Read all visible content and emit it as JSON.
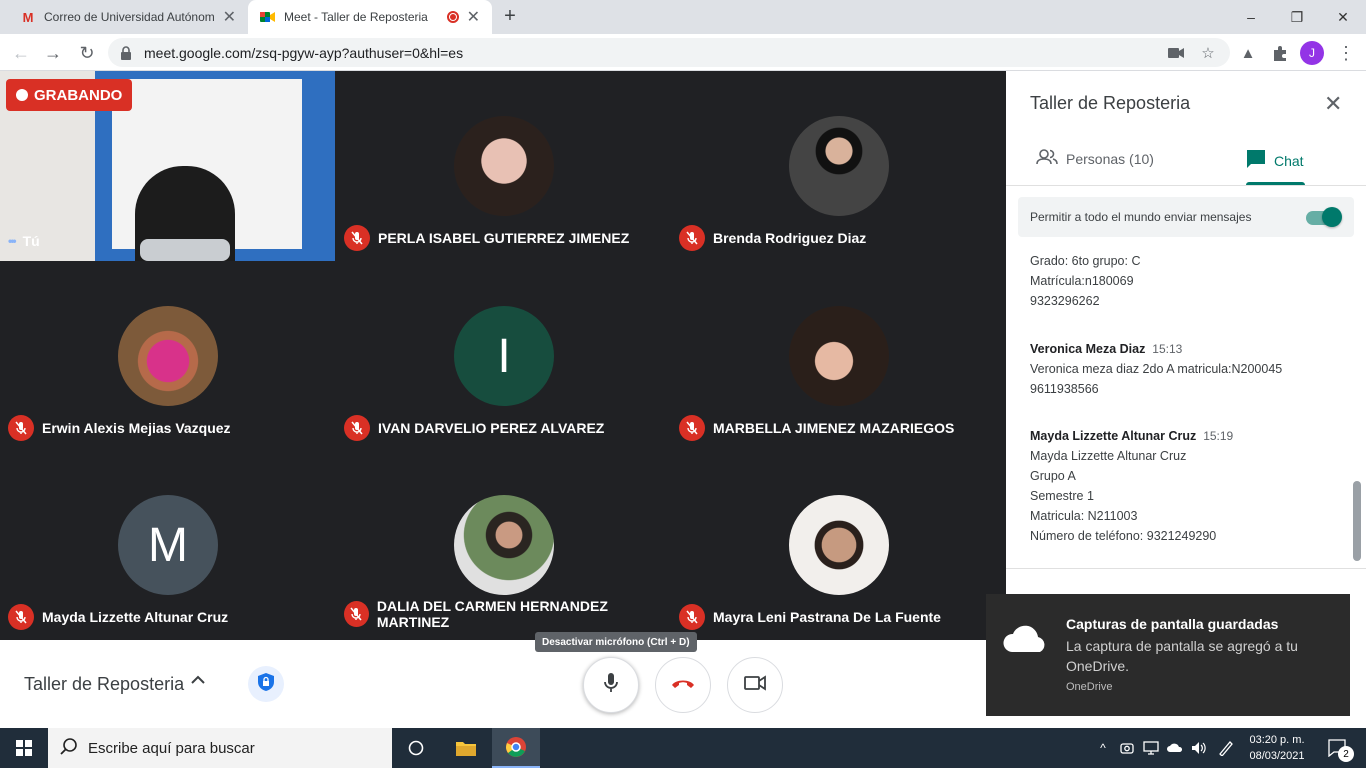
{
  "browser": {
    "tabs": [
      {
        "title": "Correo de Universidad Autónoma",
        "icon": "gmail-icon"
      },
      {
        "title": "Meet - Taller de Reposteria",
        "icon": "meet-icon",
        "recording": true
      }
    ],
    "new_tab": "+",
    "url": "meet.google.com/zsq-pgyw-ayp?authuser=0&hl=es",
    "profile_initial": "J",
    "window_controls": [
      "–",
      "❐",
      "✕"
    ]
  },
  "meeting": {
    "recording_label": "GRABANDO",
    "participants": [
      {
        "name": "Tú",
        "kind": "video",
        "muted": false
      },
      {
        "name": "PERLA ISABEL GUTIERREZ JIMENEZ",
        "kind": "photo",
        "color": "#5a3e36",
        "muted": true
      },
      {
        "name": "Brenda Rodriguez Diaz",
        "kind": "photo",
        "color": "#3a3a3a",
        "muted": true
      },
      {
        "name": "Erwin Alexis Mejias Vazquez",
        "kind": "photo",
        "color": "#c8327a",
        "muted": true
      },
      {
        "name": "IVAN DARVELIO PEREZ ALVAREZ",
        "kind": "letter",
        "letter": "I",
        "color": "#174d3e",
        "muted": true
      },
      {
        "name": "MARBELLA JIMENEZ MAZARIEGOS",
        "kind": "photo",
        "color": "#4a3a33",
        "muted": true
      },
      {
        "name": "Mayda Lizzette Altunar Cruz",
        "kind": "letter",
        "letter": "M",
        "color": "#46525c",
        "muted": true
      },
      {
        "name": "DALIA DEL CARMEN HERNANDEZ MARTINEZ",
        "kind": "photo",
        "color": "#3d5a3a",
        "muted": true
      },
      {
        "name": "Mayra Leni Pastrana De La Fuente",
        "kind": "photo",
        "color": "#e9ded8",
        "muted": true
      }
    ],
    "tooltip": "Desactivar micrófono (Ctrl + D)",
    "meeting_title": "Taller de Reposteria"
  },
  "panel": {
    "title": "Taller de Reposteria",
    "tabs": [
      {
        "label": "Personas (10)"
      },
      {
        "label": "Chat"
      }
    ],
    "allow_everyone_label": "Permitir a todo el mundo enviar mensajes",
    "messages": [
      {
        "sender": "",
        "time": "",
        "lines": [
          "Grado: 6to grupo: C",
          "Matrícula:n180069",
          "9323296262"
        ]
      },
      {
        "sender": "Veronica Meza Diaz",
        "time": "15:13",
        "lines": [
          "Veronica meza diaz 2do A matricula:N200045",
          "9611938566"
        ]
      },
      {
        "sender": "Mayda Lizzette Altunar Cruz",
        "time": "15:19",
        "lines": [
          "Mayda Lizzette Altunar Cruz",
          "Grupo A",
          "Semestre 1",
          "Matricula: N211003",
          "Número de teléfono: 9321249290"
        ]
      }
    ]
  },
  "toast": {
    "title": "Capturas de pantalla guardadas",
    "body": "La captura de pantalla se agregó a tu OneDrive.",
    "source": "OneDrive"
  },
  "taskbar": {
    "search_placeholder": "Escribe aquí para buscar",
    "time": "03:20 p. m.",
    "date": "08/03/2021",
    "notifications": "2"
  },
  "colors": {
    "accent": "#00796b",
    "danger": "#d93025",
    "stage": "#202124"
  }
}
